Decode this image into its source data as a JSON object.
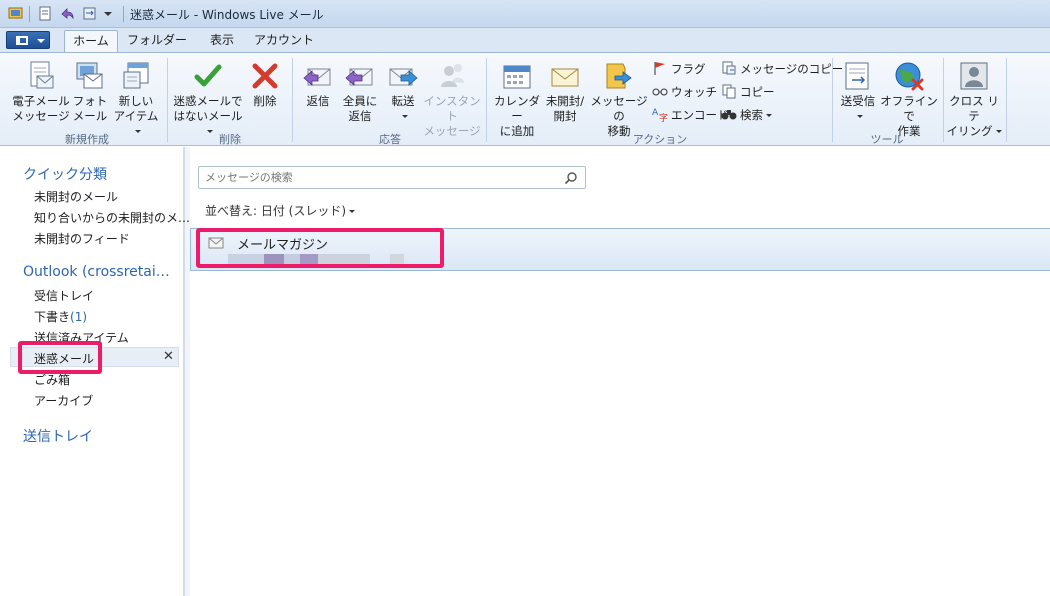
{
  "window": {
    "title": "迷惑メール - Windows Live メール"
  },
  "tabs": [
    {
      "label": "ホーム",
      "active": true
    },
    {
      "label": "フォルダー",
      "active": false
    },
    {
      "label": "表示",
      "active": false
    },
    {
      "label": "アカウント",
      "active": false
    }
  ],
  "ribbon": {
    "groups": [
      {
        "label": "新規作成",
        "buttons": [
          {
            "line1": "電子メール",
            "line2": "メッセージ",
            "icon": "new-email-icon"
          },
          {
            "line1": "フォト",
            "line2": "メール",
            "icon": "photo-email-icon"
          },
          {
            "line1": "新しい",
            "line2": "アイテム",
            "icon": "new-item-icon",
            "dropdown": true
          }
        ]
      },
      {
        "label": "削除",
        "buttons": [
          {
            "line1": "迷惑メールで",
            "line2": "はないメール",
            "icon": "not-junk-icon",
            "dropdown": true
          },
          {
            "line1": "削除",
            "line2": "",
            "icon": "delete-icon"
          }
        ]
      },
      {
        "label": "応答",
        "buttons": [
          {
            "line1": "返信",
            "line2": "",
            "icon": "reply-icon"
          },
          {
            "line1": "全員に",
            "line2": "返信",
            "icon": "reply-all-icon"
          },
          {
            "line1": "転送",
            "line2": "",
            "icon": "forward-icon",
            "dropdown": true
          },
          {
            "line1": "インスタント",
            "line2": "メッセージ",
            "icon": "instant-message-icon",
            "disabled": true
          }
        ]
      },
      {
        "label": "アクション",
        "buttons": [
          {
            "line1": "カレンダー",
            "line2": "に追加",
            "icon": "calendar-icon"
          },
          {
            "line1": "未開封/",
            "line2": "開封",
            "icon": "unread-read-icon"
          },
          {
            "line1": "メッセージの",
            "line2": "移動",
            "icon": "move-message-icon"
          }
        ],
        "small": [
          {
            "label": "フラグ",
            "icon": "flag-icon"
          },
          {
            "label": "ウォッチ",
            "icon": "watch-icon"
          },
          {
            "label": "エンコード",
            "icon": "encode-icon"
          },
          {
            "label": "メッセージのコピー",
            "icon": "copy-message-icon"
          },
          {
            "label": "コピー",
            "icon": "copy-icon"
          },
          {
            "label": "検索",
            "icon": "find-icon",
            "dropdown": true
          }
        ]
      },
      {
        "label": "ツール",
        "buttons": [
          {
            "line1": "送受信",
            "line2": "",
            "icon": "send-receive-icon",
            "dropdown": true
          },
          {
            "line1": "オフラインで",
            "line2": "作業",
            "icon": "work-offline-icon"
          }
        ]
      },
      {
        "label": "",
        "buttons": [
          {
            "line1": "クロス リテ",
            "line2": "イリング",
            "icon": "cross-retailing-icon",
            "dropdown": true
          }
        ]
      }
    ]
  },
  "sidebar": {
    "quick_views": {
      "title": "クイック分類",
      "items": [
        "未開封のメール",
        "知り合いからの未開封のメ…",
        "未開封のフィード"
      ]
    },
    "account": {
      "title": "Outlook (crossretai…",
      "items": [
        {
          "label": "受信トレイ",
          "count": ""
        },
        {
          "label": "下書き",
          "count": "(1)"
        },
        {
          "label": "送信済みアイテム",
          "count": ""
        },
        {
          "label": "迷惑メール",
          "count": "",
          "selected": true
        },
        {
          "label": "ごみ箱",
          "count": ""
        },
        {
          "label": "アーカイブ",
          "count": ""
        }
      ]
    },
    "outbox": {
      "title": "送信トレイ"
    }
  },
  "message_list": {
    "search_placeholder": "メッセージの検索",
    "sort_label": "並べ替え: 日付 (スレッド)",
    "messages": [
      {
        "sender": "メールマガジン"
      }
    ]
  },
  "colors": {
    "highlight": "#ec1c6a",
    "accent": "#2d66b0",
    "selection": "#dbe7f5"
  }
}
